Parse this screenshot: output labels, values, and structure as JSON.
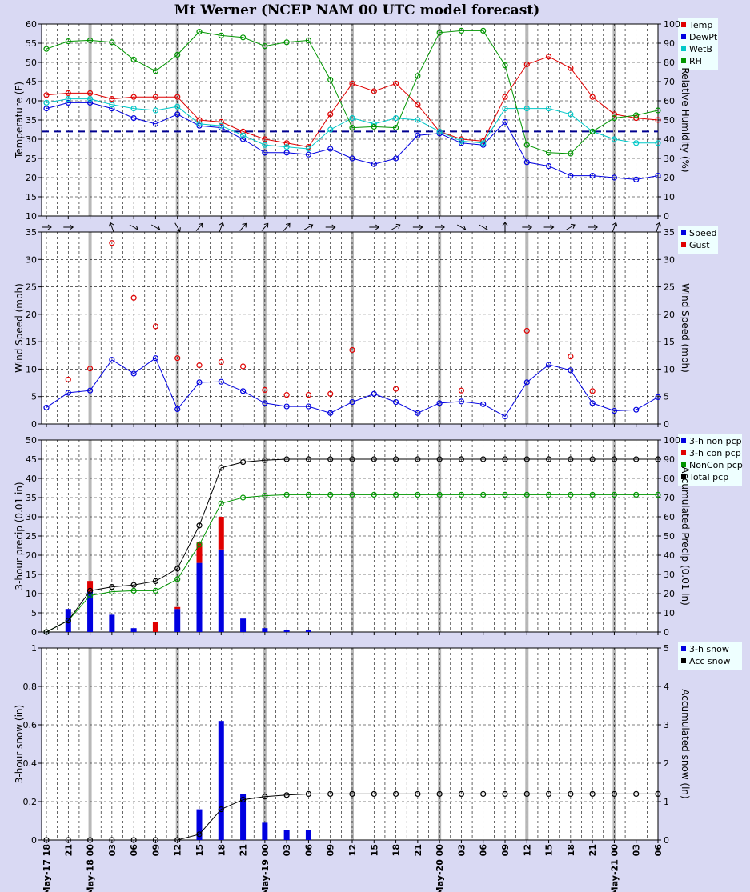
{
  "chart_data": {
    "title": "Mt Werner (NCEP NAM 00 UTC model forecast)",
    "x_tick_labels": [
      "May-17 18",
      "21",
      "May-18 00",
      "03",
      "06",
      "09",
      "12",
      "15",
      "18",
      "21",
      "May-19 00",
      "03",
      "06",
      "09",
      "12",
      "15",
      "18",
      "21",
      "May-20 00",
      "03",
      "06",
      "09",
      "12",
      "15",
      "18",
      "21",
      "May-21 00",
      "03",
      "06"
    ],
    "panels": [
      {
        "type": "line",
        "ylabel_left": "Temperature (F)",
        "ylabel_right": "Relative Humidity (%)",
        "ylim_left": [
          10,
          60
        ],
        "ylim_right": [
          0,
          100
        ],
        "freezing_line": 32,
        "legend_placement": "top-right",
        "series": [
          {
            "name": "Temp",
            "color": "#e00000",
            "axis": "left",
            "values": [
              41.5,
              42,
              42,
              40.5,
              41,
              41,
              41,
              35,
              34.5,
              32,
              30,
              29,
              28,
              36.5,
              44.5,
              42.5,
              44.5,
              39,
              32,
              30,
              29.5,
              41,
              49.5,
              51.5,
              48.5,
              41,
              36.5,
              35.5,
              35
            ]
          },
          {
            "name": "DewPt",
            "color": "#0000e0",
            "axis": "left",
            "values": [
              38,
              39.5,
              39.5,
              38,
              35.5,
              34,
              36.5,
              33.5,
              33,
              30,
              26.5,
              26.5,
              26,
              27.5,
              25,
              23.5,
              25,
              31,
              31.5,
              29,
              28.5,
              34.5,
              24,
              23,
              20.5,
              20.5,
              20,
              19.5,
              20.5
            ]
          },
          {
            "name": "WetB",
            "color": "#00c8c8",
            "axis": "left",
            "values": [
              39.5,
              40.5,
              40.5,
              39,
              38,
              37.5,
              38.5,
              34,
              33.5,
              31,
              28.5,
              28,
              27.5,
              32.5,
              35.5,
              34,
              35.5,
              35,
              32,
              29.5,
              29,
              38,
              38,
              38,
              36.5,
              32,
              30,
              29,
              29
            ]
          },
          {
            "name": "RH",
            "color": "#009600",
            "axis": "right",
            "values": [
              87,
              91,
              91.5,
              90.5,
              81.5,
              75.5,
              84,
              96,
              94,
              93,
              88.5,
              90.5,
              91.5,
              71,
              46,
              46.5,
              46,
              73,
              95.5,
              96.5,
              96.5,
              78.5,
              37,
              33,
              32.5,
              44,
              51,
              52.5,
              55
            ]
          }
        ]
      },
      {
        "type": "line",
        "ylabel_left": "Wind Speed (mph)",
        "ylabel_right": "Wind Speed (mph)",
        "ylim_left": [
          0,
          35
        ],
        "ylim_right": [
          0,
          35
        ],
        "legend_placement": "top-right",
        "wind_direction_deg": [
          90,
          90,
          null,
          340,
          120,
          120,
          150,
          40,
          20,
          40,
          40,
          40,
          60,
          90,
          null,
          90,
          60,
          90,
          90,
          120,
          120,
          360,
          90,
          90,
          60,
          90,
          20,
          null,
          20
        ],
        "series": [
          {
            "name": "Speed",
            "color": "#0000e0",
            "values": [
              3,
              5.7,
              6.1,
              11.7,
              9.2,
              12,
              2.7,
              7.6,
              7.7,
              6,
              3.8,
              3.2,
              3.2,
              2,
              4,
              5.5,
              4,
              2,
              3.8,
              4.1,
              3.6,
              1.4,
              7.6,
              10.8,
              9.8,
              3.8,
              2.4,
              2.6,
              4.9
            ]
          },
          {
            "name": "Gust",
            "color": "#e00000",
            "values": [
              null,
              8.1,
              10.1,
              33,
              23,
              17.8,
              12,
              10.7,
              11.3,
              10.5,
              6.2,
              5.3,
              5.3,
              5.5,
              13.5,
              null,
              6.4,
              null,
              null,
              6.1,
              null,
              null,
              17,
              null,
              12.3,
              6,
              null,
              null,
              null
            ]
          }
        ]
      },
      {
        "type": "bar",
        "ylabel_left": "3-hour precip (0.01 in)",
        "ylabel_right": "Accumulated Precip (0.01 in)",
        "ylim_left": [
          0,
          50
        ],
        "ylim_right": [
          0,
          100
        ],
        "legend_placement": "top-right",
        "series": [
          {
            "name": "3-h non pcp",
            "color": "#0000e0",
            "values": [
              0,
              6,
              10.5,
              4.5,
              1,
              0,
              6,
              18,
              21.5,
              3.5,
              1,
              0.5,
              0.5,
              0,
              0,
              0,
              0,
              0,
              0,
              0,
              0,
              0,
              0,
              0,
              0,
              0,
              0,
              0,
              0
            ]
          },
          {
            "name": "3-h con pcp",
            "color": "#e00000",
            "values": [
              0,
              0,
              2.8,
              0,
              0,
              2.5,
              0.5,
              5.3,
              8.5,
              0,
              0,
              0,
              0,
              0,
              0,
              0,
              0,
              0,
              0,
              0,
              0,
              0,
              0,
              0,
              0,
              0,
              0,
              0,
              0
            ]
          },
          {
            "name": "NonCon pcp",
            "color": "#009600",
            "axis": "right",
            "values": [
              0,
              6,
              19,
              21,
              21.5,
              21.5,
              27.5,
              45.5,
              67,
              70,
              71,
              71.5,
              71.5,
              71.5,
              71.5,
              71.5,
              71.5,
              71.5,
              71.5,
              71.5,
              71.5,
              71.5,
              71.5,
              71.5,
              71.5,
              71.5,
              71.5,
              71.5,
              71.5
            ]
          },
          {
            "name": "Total pcp",
            "color": "#000000",
            "axis": "right",
            "values": [
              0,
              6,
              21.5,
              23.5,
              24.5,
              26.5,
              33,
              55.5,
              85.5,
              88.5,
              89.5,
              90,
              90,
              90,
              90,
              90,
              90,
              90,
              90,
              90,
              90,
              90,
              90,
              90,
              90,
              90,
              90,
              90,
              90
            ]
          }
        ]
      },
      {
        "type": "bar",
        "ylabel_left": "3-hour snow (in)",
        "ylabel_right": "Accumulated snow (in)",
        "ylim_left": [
          0,
          1
        ],
        "ylim_right": [
          0,
          5
        ],
        "legend_placement": "top-right",
        "series": [
          {
            "name": "3-h snow",
            "color": "#0000e0",
            "values": [
              0,
              0,
              0,
              0,
              0,
              0,
              0,
              0.16,
              0.62,
              0.24,
              0.09,
              0.05,
              0.05,
              0,
              0,
              0,
              0,
              0,
              0,
              0,
              0,
              0,
              0,
              0,
              0,
              0,
              0,
              0,
              0
            ]
          },
          {
            "name": "Acc snow",
            "color": "#000000",
            "axis": "right",
            "values": [
              0,
              0,
              0,
              0,
              0,
              0,
              0,
              0.15,
              0.8,
              1.05,
              1.13,
              1.17,
              1.2,
              1.2,
              1.2,
              1.2,
              1.2,
              1.2,
              1.2,
              1.2,
              1.2,
              1.2,
              1.2,
              1.2,
              1.2,
              1.2,
              1.2,
              1.2,
              1.2
            ]
          }
        ]
      }
    ]
  }
}
